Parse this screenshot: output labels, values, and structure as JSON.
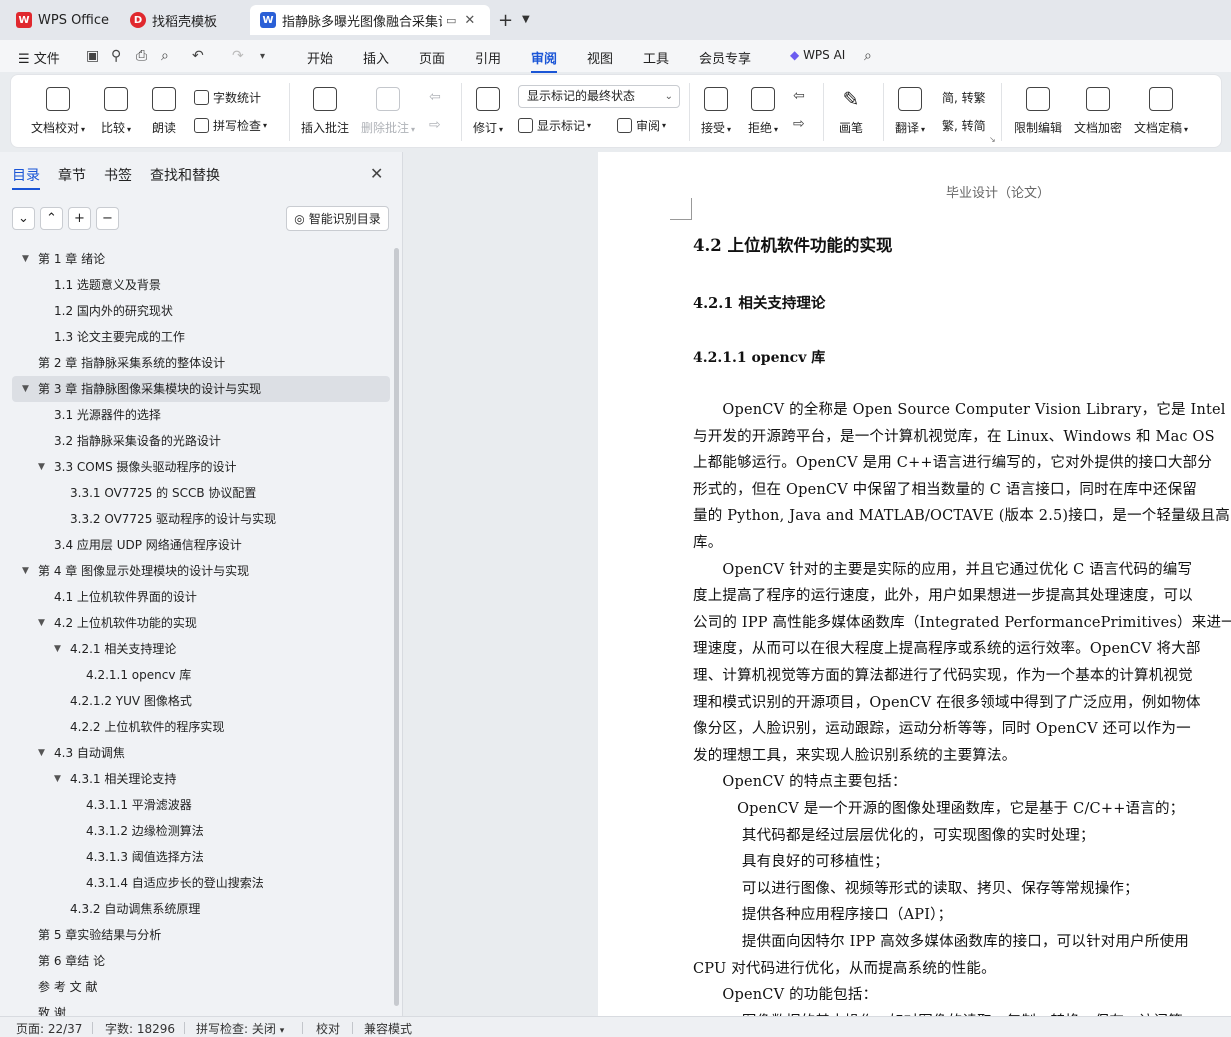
{
  "tabs": [
    {
      "label": "WPS Office",
      "icon": "wps-logo-icon",
      "color": "#e0282e"
    },
    {
      "label": "找稻壳模板",
      "icon": "docer-icon",
      "color": "#e0282e"
    },
    {
      "label": "指静脉多曝光图像融合采集设",
      "icon": "word-doc-icon",
      "color": "#2a5fd6"
    }
  ],
  "menu": {
    "file": "文件",
    "items": [
      "开始",
      "插入",
      "页面",
      "引用",
      "审阅",
      "视图",
      "工具",
      "会员专享"
    ],
    "active": "审阅",
    "ai": "WPS AI"
  },
  "ribbon": {
    "doc_check": "文档校对",
    "compare": "比较",
    "read_aloud": "朗读",
    "word_count": "字数统计",
    "spell_check": "拼写检查",
    "insert_comment": "插入批注",
    "delete_comment": "删除批注",
    "track": "修订",
    "markup_dropdown": "显示标记的最终状态",
    "show_markup": "显示标记",
    "review_pane": "审阅",
    "accept": "接受",
    "reject": "拒绝",
    "pen": "画笔",
    "translate": "翻译",
    "simp_to_trad": "简, 转繁",
    "trad_to_simp": "繁, 转简",
    "restrict": "限制编辑",
    "encrypt": "文档加密",
    "finalize": "文档定稿"
  },
  "leftpane": {
    "tabs": [
      "目录",
      "章节",
      "书签",
      "查找和替换"
    ],
    "smart_toc": "智能识别目录",
    "toc": [
      {
        "text": "第 1 章  绪论",
        "level": 0,
        "expanded": true
      },
      {
        "text": "1.1  选题意义及背景",
        "level": 1
      },
      {
        "text": "1.2  国内外的研究现状",
        "level": 1
      },
      {
        "text": "1.3  论文主要完成的工作",
        "level": 1
      },
      {
        "text": "第 2 章  指静脉采集系统的整体设计",
        "level": 0
      },
      {
        "text": "第 3 章  指静脉图像采集模块的设计与实现",
        "level": 0,
        "expanded": true,
        "selected": true
      },
      {
        "text": "3.1  光源器件的选择",
        "level": 1
      },
      {
        "text": "3.2  指静脉采集设备的光路设计",
        "level": 1
      },
      {
        "text": "3.3 COMS 摄像头驱动程序的设计",
        "level": 1,
        "expanded": true
      },
      {
        "text": "3.3.1 OV7725 的 SCCB 协议配置",
        "level": 2
      },
      {
        "text": "3.3.2 OV7725 驱动程序的设计与实现",
        "level": 2
      },
      {
        "text": "3.4  应用层 UDP 网络通信程序设计",
        "level": 1
      },
      {
        "text": "第 4 章  图像显示处理模块的设计与实现",
        "level": 0,
        "expanded": true
      },
      {
        "text": "4.1  上位机软件界面的设计",
        "level": 1
      },
      {
        "text": "4.2  上位机软件功能的实现",
        "level": 1,
        "expanded": true
      },
      {
        "text": "4.2.1  相关支持理论",
        "level": 2,
        "expanded": true
      },
      {
        "text": "4.2.1.1 opencv 库",
        "level": 3
      },
      {
        "text": "4.2.1.2 YUV 图像格式",
        "level": 2
      },
      {
        "text": "4.2.2  上位机软件的程序实现",
        "level": 2
      },
      {
        "text": "4.3  自动调焦",
        "level": 1,
        "expanded": true
      },
      {
        "text": "4.3.1  相关理论支持",
        "level": 2,
        "expanded": true
      },
      {
        "text": "4.3.1.1  平滑滤波器",
        "level": 3
      },
      {
        "text": "4.3.1.2  边缘检测算法",
        "level": 3
      },
      {
        "text": "4.3.1.3  阈值选择方法",
        "level": 3
      },
      {
        "text": "4.3.1.4  自适应步长的登山搜索法",
        "level": 3
      },
      {
        "text": "4.3.2 自动调焦系统原理",
        "level": 2
      },
      {
        "text": "第 5 章实验结果与分析",
        "level": 0
      },
      {
        "text": "第 6 章结  论",
        "level": 0
      },
      {
        "text": "参  考  文  献",
        "level": 0
      },
      {
        "text": "致    谢",
        "level": 0
      }
    ]
  },
  "document": {
    "header": "毕业设计（论文）",
    "h1": "4.2  上位机软件功能的实现",
    "h2": "4.2.1  相关支持理论",
    "h3": "4.2.1.1 opencv 库",
    "lines": [
      "　　OpenCV 的全称是  Open Source Computer Vision Library，它是  Intel  公司",
      "与开发的开源跨平台，是一个计算机视觉库，在  Linux、Windows 和 Mac OS",
      "上都能够运行。OpenCV 是用  C++语言进行编写的，它对外提供的接口大部分",
      "形式的，但在  OpenCV  中保留了相当数量的  C  语言接口，同时在库中还保留",
      "量的  Python, Java and MATLAB/OCTAVE (版本 2.5)接口，是一个轻量级且高",
      "库。",
      "　　OpenCV 针对的主要是实际的应用，并且它通过优化  C  语言代码的编写",
      "度上提高了程序的运行速度，此外，用户如果想进一步提高其处理速度，可以",
      "公司的  IPP 高性能多媒体函数库（Integrated PerformancePrimitives）来进一步",
      "理速度，从而可以在很大程度上提高程序或系统的运行效率。OpenCV 将大部",
      "理、计算机视觉等方面的算法都进行了代码实现，作为一个基本的计算机视觉",
      "理和模式识别的开源项目，OpenCV 在很多领域中得到了广泛应用，例如物体",
      "像分区，人脸识别，运动跟踪，运动分析等等，同时  OpenCV 还可以作为一",
      "发的理想工具，来实现人脸识别系统的主要算法。",
      "　　OpenCV  的特点主要包括：",
      "　　　OpenCV 是一个开源的图像处理函数库，它是基于  C/C++语言的；",
      "　　　 其代码都是经过层层优化的，可实现图像的实时处理；",
      "　　　 具有良好的可移植性；",
      "　　　 可以进行图像、视频等形式的读取、拷贝、保存等常规操作；",
      "　　　 提供各种应用程序接口（API）；",
      "　　　 提供面向因特尔  IPP  高效多媒体函数库的接口，可以针对用户所使用",
      "CPU  对代码进行优化，从而提高系统的性能。",
      "　　OpenCV  的功能包括：",
      "　　　 图像数据的基本操作，如对图像的读取、复制、转换、保存、访问等"
    ]
  },
  "status": {
    "page": "页面: 22/37",
    "words": "字数: 18296",
    "spell": "拼写检查: 关闭",
    "proof": "校对",
    "compat": "兼容模式"
  }
}
